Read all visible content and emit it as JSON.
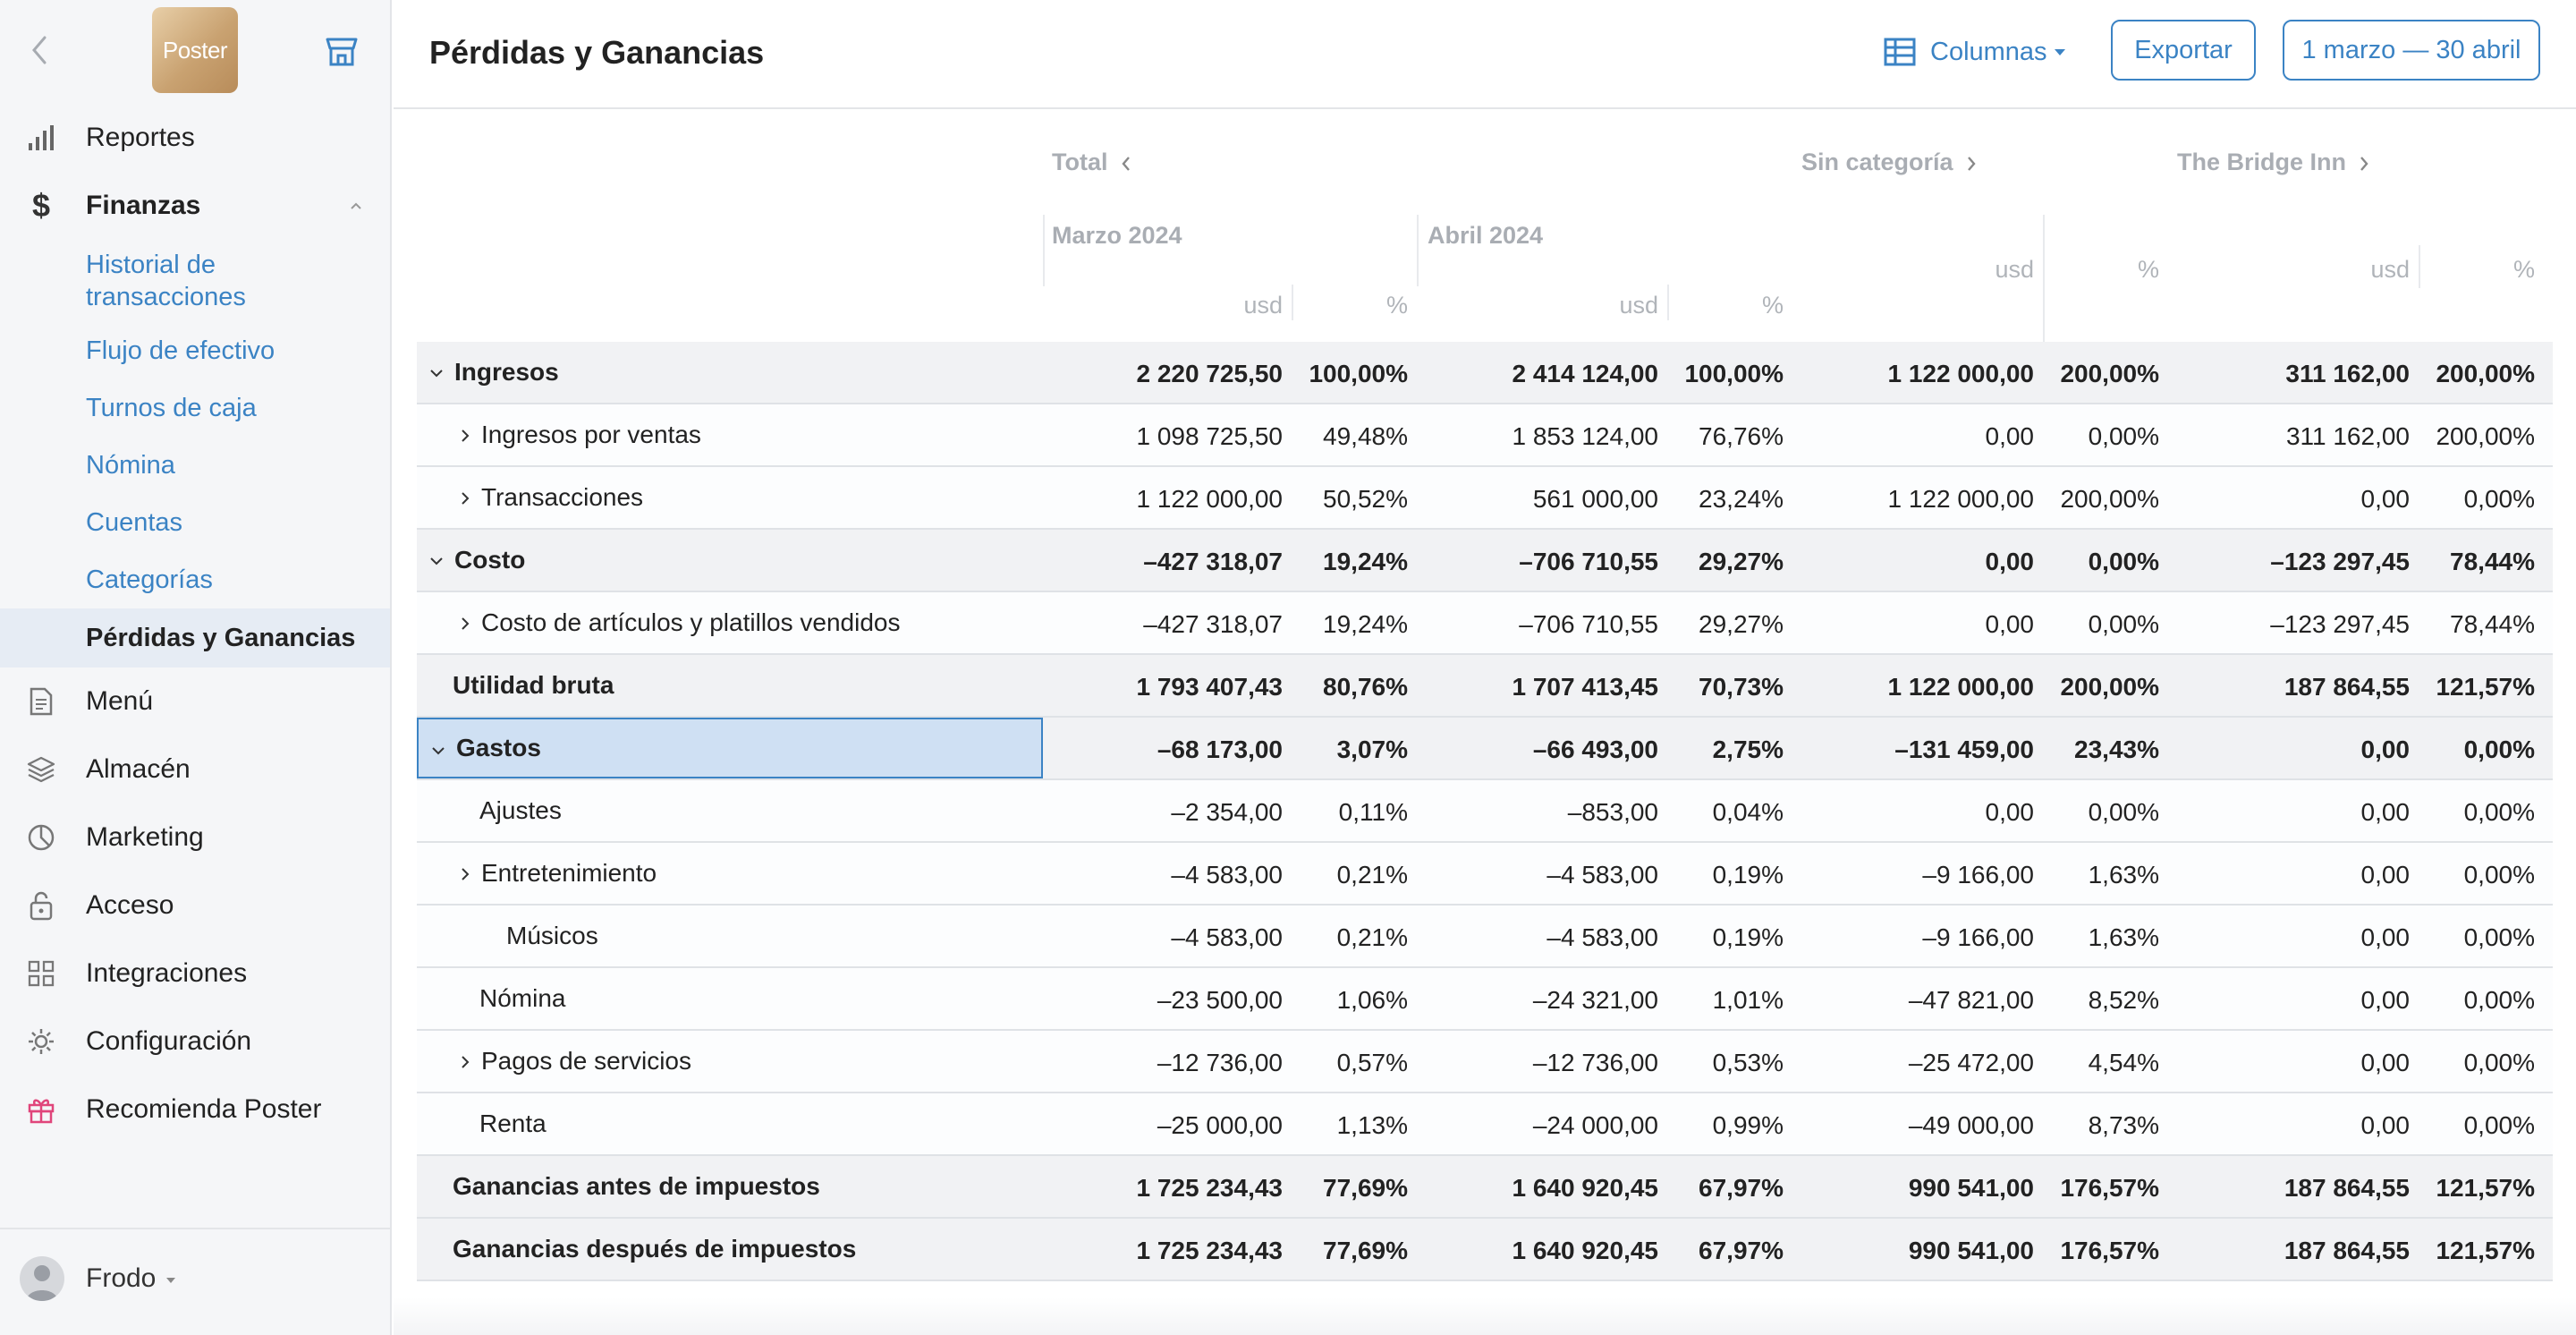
{
  "sidebar": {
    "logo_text": "Poster",
    "nav": [
      {
        "label": "Reportes",
        "icon": "bar-chart-icon"
      },
      {
        "label": "Finanzas",
        "icon": "dollar-icon"
      },
      {
        "label": "Menú",
        "icon": "document-icon"
      },
      {
        "label": "Almacén",
        "icon": "layers-icon"
      },
      {
        "label": "Marketing",
        "icon": "pie-icon"
      },
      {
        "label": "Acceso",
        "icon": "lock-icon"
      },
      {
        "label": "Integraciones",
        "icon": "grid-icon"
      },
      {
        "label": "Configuración",
        "icon": "gear-icon"
      },
      {
        "label": "Recomienda Poster",
        "icon": "gift-icon"
      }
    ],
    "finanzas_sub": [
      {
        "line1": "Historial de",
        "line2": "transacciones"
      },
      {
        "line1": "Flujo de efectivo",
        "line2": ""
      },
      {
        "line1": "Turnos de caja",
        "line2": ""
      },
      {
        "line1": "Nómina",
        "line2": ""
      },
      {
        "line1": "Cuentas",
        "line2": ""
      },
      {
        "line1": "Categorías",
        "line2": ""
      },
      {
        "line1": "Pérdidas y Ganancias",
        "line2": ""
      }
    ],
    "user": "Frodo"
  },
  "header": {
    "title": "Pérdidas y Ganancias",
    "columns_label": "Columnas",
    "export_label": "Exportar",
    "date_range": "1 marzo — 30 abril"
  },
  "table": {
    "groups": {
      "total": "Total",
      "sin_categoria": "Sin categoría",
      "bridge": "The Bridge Inn"
    },
    "periods": {
      "p1": "Marzo 2024",
      "p2": "Abril 2024"
    },
    "units": {
      "usd": "usd",
      "pct": "%"
    },
    "rows": [
      {
        "name": "Ingresos",
        "level": 0,
        "chev": "down",
        "hl": true,
        "v": [
          "2 220 725,50",
          "100,00%",
          "2 414 124,00",
          "100,00%",
          "1 122 000,00",
          "200,00%",
          "311 162,00",
          "200,00%"
        ]
      },
      {
        "name": "Ingresos por ventas",
        "level": 1,
        "chev": "right",
        "hl": false,
        "v": [
          "1 098 725,50",
          "49,48%",
          "1 853 124,00",
          "76,76%",
          "0,00",
          "0,00%",
          "311 162,00",
          "200,00%"
        ]
      },
      {
        "name": "Transacciones",
        "level": 1,
        "chev": "right",
        "hl": false,
        "v": [
          "1 122 000,00",
          "50,52%",
          "561 000,00",
          "23,24%",
          "1 122 000,00",
          "200,00%",
          "0,00",
          "0,00%"
        ]
      },
      {
        "name": "Costo",
        "level": 0,
        "chev": "down",
        "hl": true,
        "v": [
          "–427 318,07",
          "19,24%",
          "–706 710,55",
          "29,27%",
          "0,00",
          "0,00%",
          "–123 297,45",
          "78,44%"
        ]
      },
      {
        "name": "Costo de artículos y platillos vendidos",
        "level": 1,
        "chev": "right",
        "hl": false,
        "v": [
          "–427 318,07",
          "19,24%",
          "–706 710,55",
          "29,27%",
          "0,00",
          "0,00%",
          "–123 297,45",
          "78,44%"
        ]
      },
      {
        "name": "Utilidad bruta",
        "level": 0,
        "chev": "none",
        "hl": true,
        "v": [
          "1 793 407,43",
          "80,76%",
          "1 707 413,45",
          "70,73%",
          "1 122 000,00",
          "200,00%",
          "187 864,55",
          "121,57%"
        ]
      },
      {
        "name": "Gastos",
        "level": 0,
        "chev": "down",
        "hl": true,
        "sel": true,
        "v": [
          "–68 173,00",
          "3,07%",
          "–66 493,00",
          "2,75%",
          "–131 459,00",
          "23,43%",
          "0,00",
          "0,00%"
        ]
      },
      {
        "name": "Ajustes",
        "level": 1,
        "chev": "none",
        "hl": false,
        "v": [
          "–2 354,00",
          "0,11%",
          "–853,00",
          "0,04%",
          "0,00",
          "0,00%",
          "0,00",
          "0,00%"
        ]
      },
      {
        "name": "Entretenimiento",
        "level": 1,
        "chev": "right",
        "hl": false,
        "v": [
          "–4 583,00",
          "0,21%",
          "–4 583,00",
          "0,19%",
          "–9 166,00",
          "1,63%",
          "0,00",
          "0,00%"
        ]
      },
      {
        "name": "Músicos",
        "level": 2,
        "chev": "none",
        "hl": false,
        "v": [
          "–4 583,00",
          "0,21%",
          "–4 583,00",
          "0,19%",
          "–9 166,00",
          "1,63%",
          "0,00",
          "0,00%"
        ]
      },
      {
        "name": "Nómina",
        "level": 1,
        "chev": "none",
        "hl": false,
        "v": [
          "–23 500,00",
          "1,06%",
          "–24 321,00",
          "1,01%",
          "–47 821,00",
          "8,52%",
          "0,00",
          "0,00%"
        ]
      },
      {
        "name": "Pagos de servicios",
        "level": 1,
        "chev": "right",
        "hl": false,
        "v": [
          "–12 736,00",
          "0,57%",
          "–12 736,00",
          "0,53%",
          "–25 472,00",
          "4,54%",
          "0,00",
          "0,00%"
        ]
      },
      {
        "name": "Renta",
        "level": 1,
        "chev": "none",
        "hl": false,
        "v": [
          "–25 000,00",
          "1,13%",
          "–24 000,00",
          "0,99%",
          "–49 000,00",
          "8,73%",
          "0,00",
          "0,00%"
        ]
      },
      {
        "name": "Ganancias antes de impuestos",
        "level": 0,
        "chev": "none",
        "hl": true,
        "v": [
          "1 725 234,43",
          "77,69%",
          "1 640 920,45",
          "67,97%",
          "990 541,00",
          "176,57%",
          "187 864,55",
          "121,57%"
        ]
      },
      {
        "name": "Ganancias después de impuestos",
        "level": 0,
        "chev": "none",
        "hl": true,
        "v": [
          "1 725 234,43",
          "77,69%",
          "1 640 920,45",
          "67,97%",
          "990 541,00",
          "176,57%",
          "187 864,55",
          "121,57%"
        ]
      }
    ]
  },
  "colors": {
    "accent": "#3b83c4",
    "selected_bg": "#cfe0f3",
    "row_highlight": "#f1f2f4",
    "gift": "#e0457b"
  }
}
